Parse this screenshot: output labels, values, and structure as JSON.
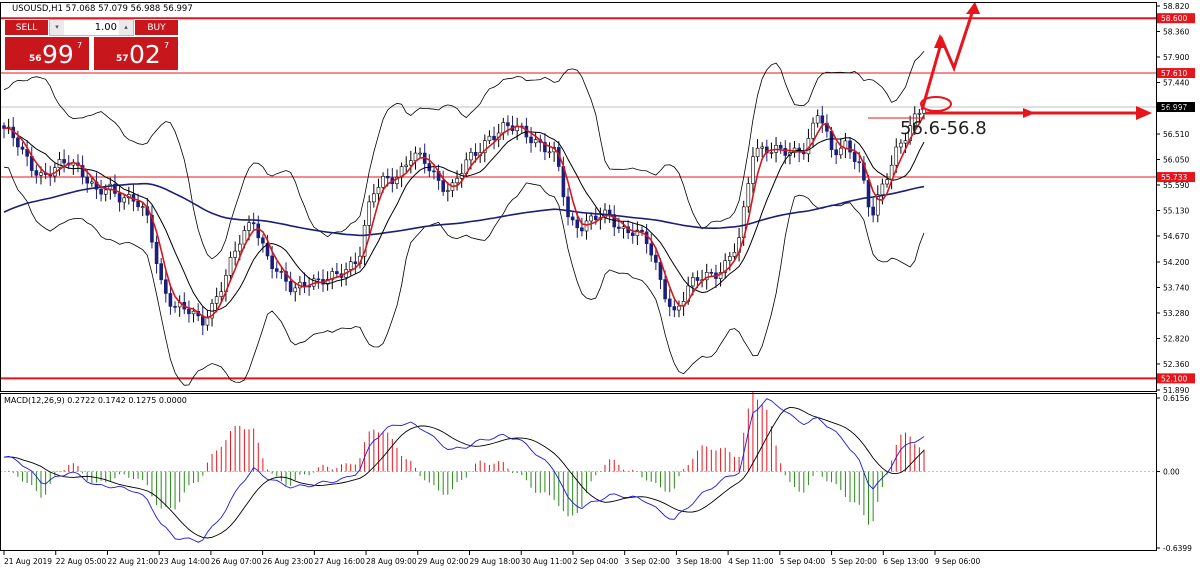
{
  "header": {
    "symbol_line": "USOUSD,H1  57.068 57.079 56.988 56.997"
  },
  "trade_panel": {
    "sell_label": "SELL",
    "buy_label": "BUY",
    "lot_value": "1.00",
    "sell_price": {
      "small": "56",
      "big": "99",
      "sup": "7"
    },
    "buy_price": {
      "small": "57",
      "big": "02",
      "sup": "7"
    },
    "panel_color": "#c8161d"
  },
  "annotation": {
    "text": "56.6-56.8",
    "color": "#e8141c"
  },
  "chart_data": [
    {
      "type": "candlestick",
      "panel": "price",
      "ylim": [
        51.89,
        58.82
      ],
      "y_ticks": [
        "58.820",
        "58.360",
        "57.900",
        "57.440",
        "56.970",
        "56.510",
        "56.050",
        "55.590",
        "55.130",
        "54.670",
        "54.200",
        "53.740",
        "53.280",
        "52.820",
        "52.360",
        "51.890"
      ],
      "x_ticks": [
        "21 Aug 2019",
        "22 Aug 05:00",
        "22 Aug 21:00",
        "23 Aug 14:00",
        "26 Aug 07:00",
        "26 Aug 23:00",
        "27 Aug 16:00",
        "28 Aug 09:00",
        "29 Aug 02:00",
        "29 Aug 18:00",
        "30 Aug 11:00",
        "2 Sep 04:00",
        "3 Sep 02:00",
        "3 Sep 18:00",
        "4 Sep 11:00",
        "5 Sep 04:00",
        "5 Sep 20:00",
        "6 Sep 13:00",
        "9 Sep 06:00"
      ],
      "horizontal_levels": [
        {
          "label": "58.600",
          "value": 58.6,
          "color": "#e8141c"
        },
        {
          "label": "57.610",
          "value": 57.61,
          "color": "#e8141c"
        },
        {
          "label": "55.733",
          "value": 55.733,
          "color": "#e8141c"
        },
        {
          "label": "52.100",
          "value": 52.1,
          "color": "#e8141c"
        }
      ],
      "current_price": {
        "label": "56.997",
        "value": 56.997
      },
      "close": [
        56.55,
        56.4,
        56.0,
        55.65,
        55.9,
        56.1,
        55.8,
        55.4,
        55.55,
        55.4,
        55.3,
        54.9,
        53.8,
        53.4,
        53.3,
        53.1,
        53.5,
        54.0,
        54.6,
        55.0,
        54.3,
        53.9,
        53.7,
        53.9,
        53.8,
        53.9,
        54.1,
        54.3,
        55.4,
        55.7,
        55.8,
        56.1,
        56.0,
        55.7,
        55.5,
        55.9,
        56.2,
        56.5,
        56.6,
        56.6,
        56.5,
        56.3,
        56.1,
        54.9,
        54.9,
        55.0,
        55.0,
        54.8,
        54.8,
        54.5,
        53.8,
        53.3,
        53.7,
        53.9,
        54.0,
        54.2,
        54.6,
        56.2,
        56.3,
        56.2,
        56.1,
        56.3,
        57.0,
        56.1,
        56.3,
        56.1,
        55.0,
        55.6,
        56.3,
        56.7,
        56.99
      ],
      "overlays": [
        {
          "name": "fast-ma",
          "color": "#d4161d"
        },
        {
          "name": "slow-ma",
          "color": "#1b1f78"
        },
        {
          "name": "bollinger",
          "color": "#000000"
        }
      ],
      "grid": false
    },
    {
      "type": "histogram+line",
      "panel": "indicator",
      "title": "MACD(12,26,9) 0.2722 0.1742 0.1275 0.0000",
      "ylim": [
        -0.6399,
        0.6156
      ],
      "y_ticks": [
        "0.6156",
        "0.00",
        "-0.6399"
      ],
      "series_colors": {
        "positive": "#e8141c",
        "negative": "#2a8a1a",
        "macd": "#1a1ae0",
        "signal": "#000000"
      },
      "macd": [
        0.12,
        0.1,
        0.0,
        -0.1,
        -0.05,
        0.0,
        -0.05,
        -0.12,
        -0.12,
        -0.14,
        -0.16,
        -0.25,
        -0.45,
        -0.55,
        -0.57,
        -0.58,
        -0.45,
        -0.3,
        -0.1,
        0.02,
        -0.05,
        -0.1,
        -0.13,
        -0.12,
        -0.1,
        -0.08,
        -0.06,
        0.0,
        0.25,
        0.35,
        0.4,
        0.4,
        0.35,
        0.25,
        0.18,
        0.2,
        0.25,
        0.28,
        0.3,
        0.28,
        0.2,
        0.1,
        0.0,
        -0.25,
        -0.3,
        -0.25,
        -0.2,
        -0.2,
        -0.22,
        -0.25,
        -0.35,
        -0.4,
        -0.3,
        -0.2,
        -0.12,
        -0.05,
        0.0,
        0.5,
        0.6,
        0.55,
        0.45,
        0.4,
        0.45,
        0.35,
        0.25,
        0.1,
        -0.15,
        -0.05,
        0.15,
        0.25,
        0.28
      ]
    }
  ]
}
